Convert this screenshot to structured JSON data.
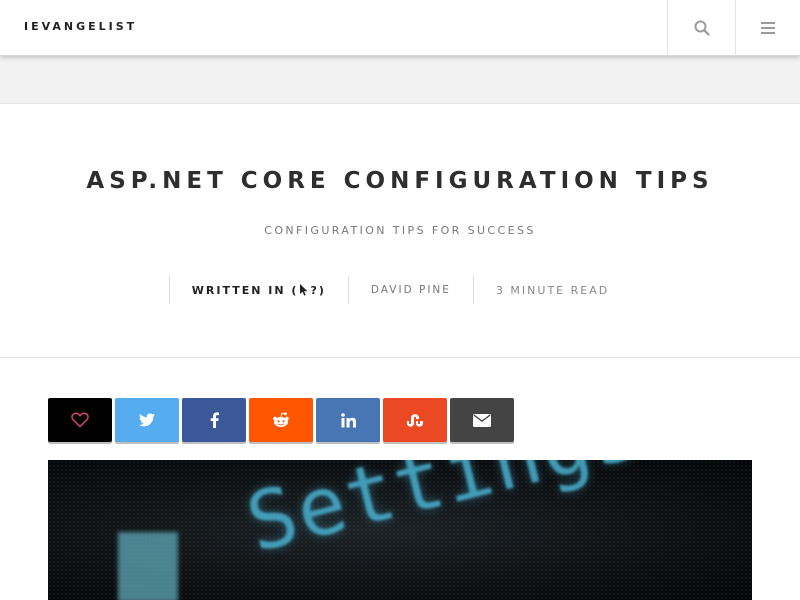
{
  "header": {
    "brand": "IEVANGELIST",
    "search_icon": "search-icon",
    "menu_icon": "hamburger-menu-icon"
  },
  "post": {
    "title": "ASP.NET CORE CONFIGURATION TIPS",
    "subtitle": "CONFIGURATION TIPS FOR SUCCESS",
    "meta": {
      "written_in_prefix": "WRITTEN IN (",
      "written_in_suffix": "?)",
      "author": "DAVID PINE",
      "read_time": "3 MINUTE READ"
    }
  },
  "share": [
    {
      "name": "like",
      "icon": "heart-icon",
      "color": "#000000"
    },
    {
      "name": "twitter",
      "icon": "twitter-icon",
      "color": "#55acee"
    },
    {
      "name": "facebook",
      "icon": "facebook-icon",
      "color": "#3b5998"
    },
    {
      "name": "reddit",
      "icon": "reddit-icon",
      "color": "#ff5700"
    },
    {
      "name": "linkedin",
      "icon": "linkedin-icon",
      "color": "#4875b4"
    },
    {
      "name": "stumbleupon",
      "icon": "stumbleupon-icon",
      "color": "#eb4924"
    },
    {
      "name": "email",
      "icon": "envelope-icon",
      "color": "#444444"
    }
  ],
  "hero": {
    "text": "Settings"
  },
  "colors": {
    "heart": "#e0457b",
    "header_icon": "#9a9a9a"
  }
}
